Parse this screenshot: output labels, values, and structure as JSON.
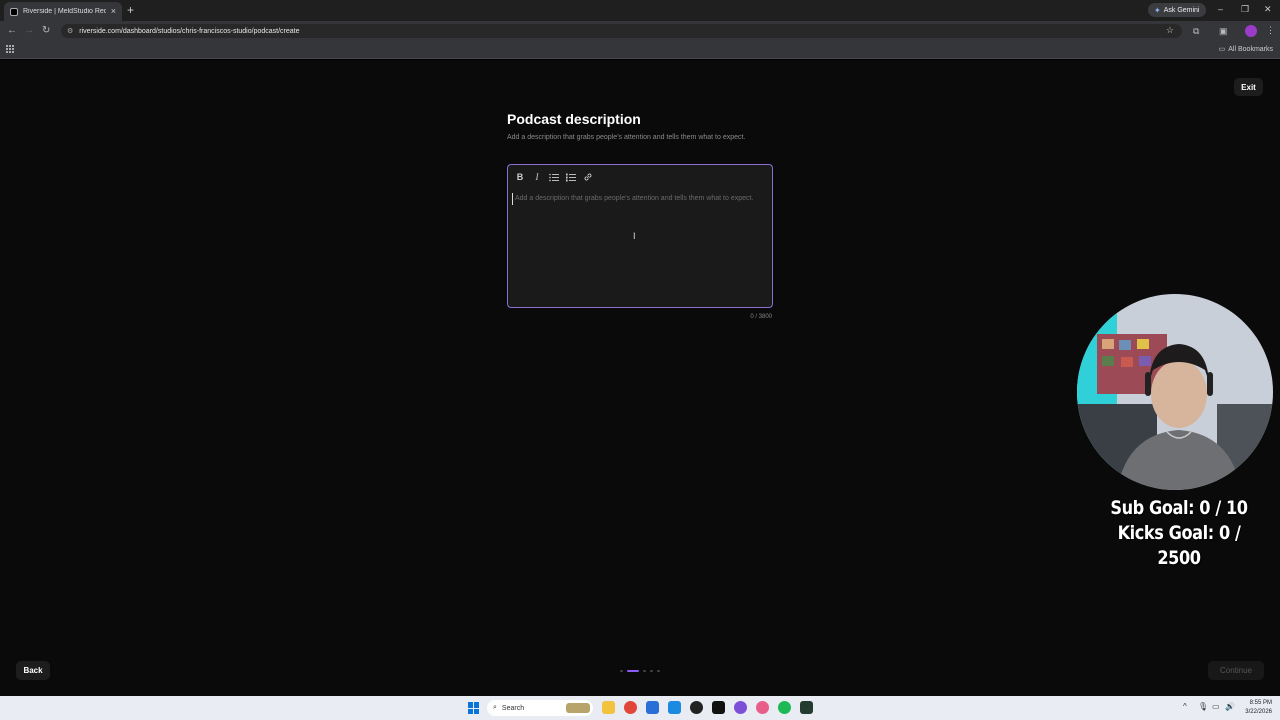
{
  "browser": {
    "tab_title": "Riverside | MeldStudio Recordi",
    "new_tab_label": "+",
    "tab_close_label": "×",
    "ask_gemini": "Ask Gemini",
    "url": "riverside.com/dashboard/studios/chris-franciscos-studio/podcast/create",
    "all_bookmarks": "All Bookmarks"
  },
  "page": {
    "exit_label": "Exit",
    "title": "Podcast description",
    "subtitle": "Add a description that grabs people’s attention and tells them what to expect.",
    "editor": {
      "toolbar": [
        "B",
        "I",
        "≔",
        "⋮≡",
        "🔗"
      ],
      "placeholder": "Add a description that grabs people’s attention and tells them what to expect.",
      "value": ""
    },
    "char_counter": "0 / 3800",
    "back_label": "Back",
    "continue_label": "Continue",
    "progress": {
      "steps": 5,
      "current": 2
    }
  },
  "overlay": {
    "sub_goal": "Sub Goal:  0 / 10",
    "kicks_goal": "Kicks Goal:  0 / 2500"
  },
  "taskbar": {
    "search_label": "Search",
    "time": "8:55 PM",
    "date": "3/22/2026"
  }
}
